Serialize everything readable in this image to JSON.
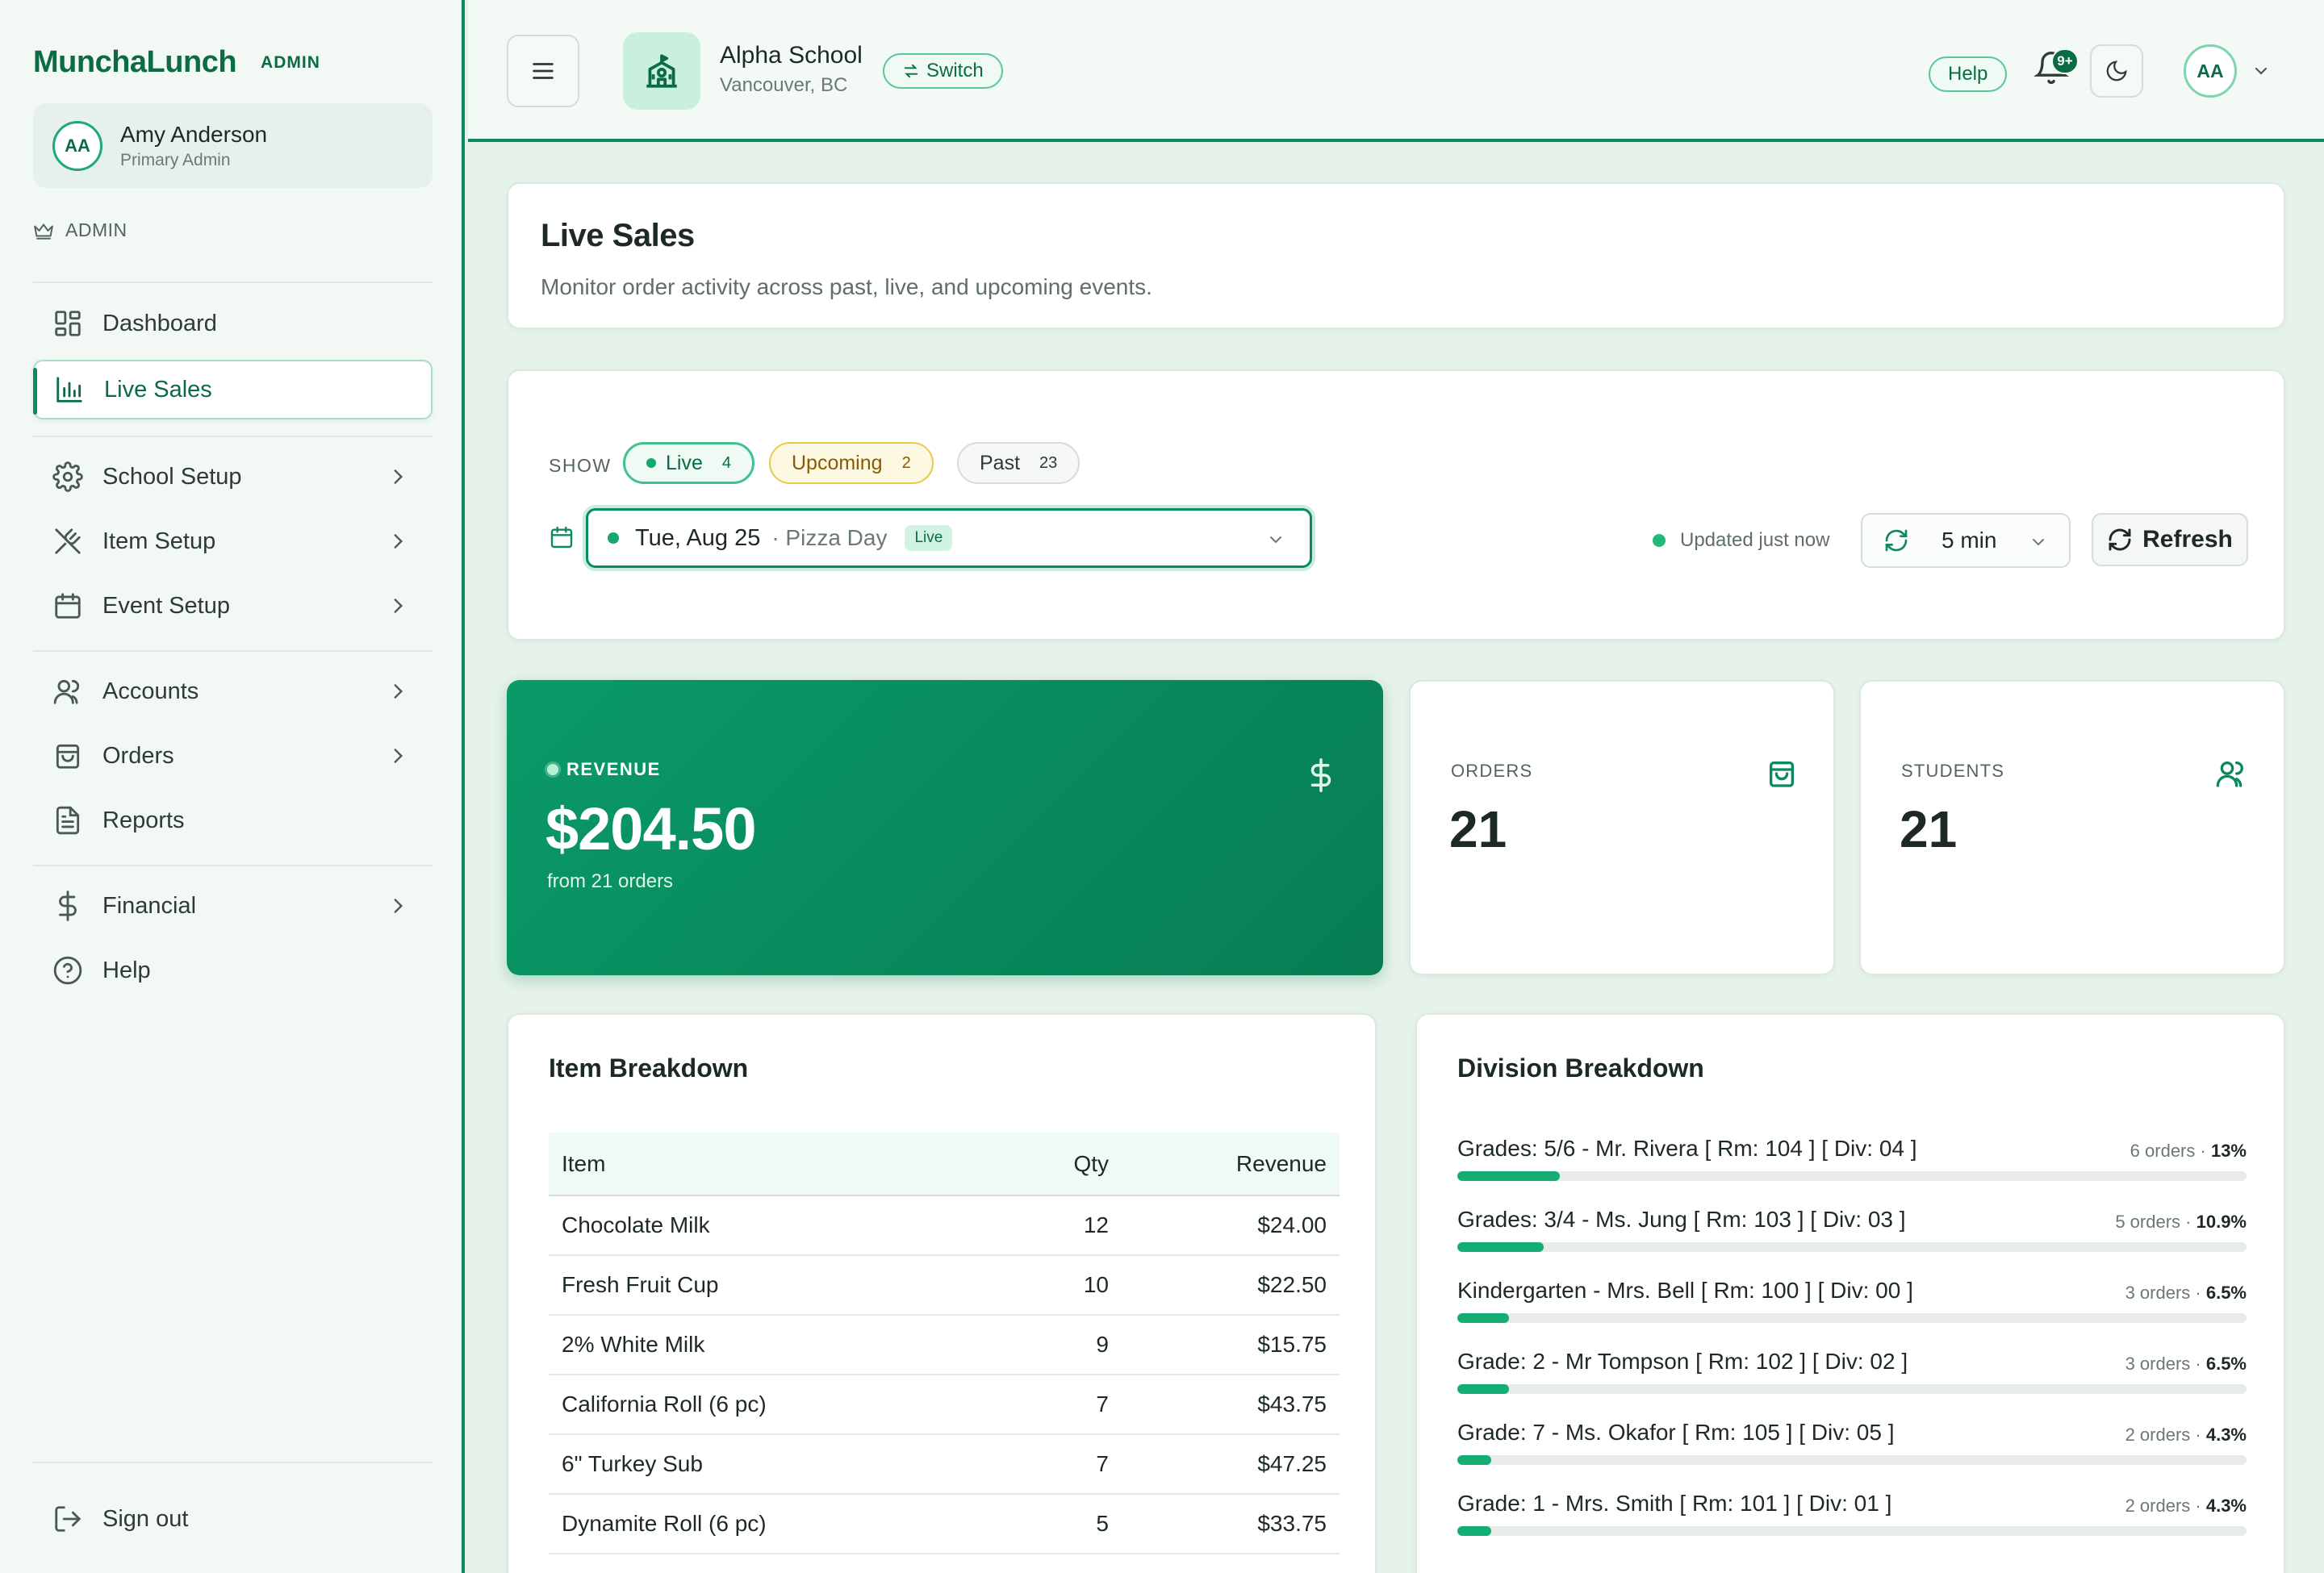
{
  "brand": {
    "name": "MunchaLunch",
    "tag": "ADMIN"
  },
  "user": {
    "initials": "AA",
    "name": "Amy Anderson",
    "role": "Primary Admin"
  },
  "sidebar": {
    "role_label": "ADMIN",
    "items": [
      {
        "label": "Dashboard",
        "icon": "dashboard-icon"
      },
      {
        "label": "Live Sales",
        "icon": "bar-chart-icon",
        "active": true
      },
      {
        "label": "School Setup",
        "icon": "gear-icon"
      },
      {
        "label": "Item Setup",
        "icon": "utensils-icon"
      },
      {
        "label": "Event Setup",
        "icon": "calendar-icon"
      },
      {
        "label": "Accounts",
        "icon": "users-icon"
      },
      {
        "label": "Orders",
        "icon": "shopping-bag-icon"
      },
      {
        "label": "Reports",
        "icon": "document-icon"
      },
      {
        "label": "Financial",
        "icon": "dollar-icon"
      },
      {
        "label": "Help",
        "icon": "help-circle-icon"
      }
    ],
    "sign_out": "Sign out"
  },
  "header": {
    "school_name": "Alpha School",
    "school_location": "Vancouver, BC",
    "switch_label": "Switch",
    "help_label": "Help",
    "notification_badge": "9+",
    "avatar_initials": "AA"
  },
  "page": {
    "title": "Live Sales",
    "subtitle": "Monitor order activity across past, live, and upcoming events."
  },
  "filters": {
    "show_label": "SHOW",
    "live": {
      "label": "Live",
      "count": "4"
    },
    "upcoming": {
      "label": "Upcoming",
      "count": "2"
    },
    "past": {
      "label": "Past",
      "count": "23"
    },
    "event": {
      "date": "Tue, Aug 25",
      "name": "· Pizza Day",
      "badge": "Live"
    },
    "updated_text": "Updated just now",
    "interval": "5 min",
    "refresh_label": "Refresh"
  },
  "kpis": {
    "revenue": {
      "label": "REVENUE",
      "value": "$204.50",
      "sub": "from 21 orders"
    },
    "orders": {
      "label": "ORDERS",
      "value": "21"
    },
    "students": {
      "label": "STUDENTS",
      "value": "21"
    }
  },
  "item_breakdown": {
    "title": "Item Breakdown",
    "columns": [
      "Item",
      "Qty",
      "Revenue"
    ],
    "rows": [
      {
        "item": "Chocolate Milk",
        "qty": "12",
        "revenue": "$24.00"
      },
      {
        "item": "Fresh Fruit Cup",
        "qty": "10",
        "revenue": "$22.50"
      },
      {
        "item": "2% White Milk",
        "qty": "9",
        "revenue": "$15.75"
      },
      {
        "item": "California Roll (6 pc)",
        "qty": "7",
        "revenue": "$43.75"
      },
      {
        "item": "6\" Turkey Sub",
        "qty": "7",
        "revenue": "$47.25"
      },
      {
        "item": "Dynamite Roll (6 pc)",
        "qty": "5",
        "revenue": "$33.75"
      }
    ]
  },
  "division_breakdown": {
    "title": "Division Breakdown",
    "rows": [
      {
        "name": "Grades: 5/6 - Mr. Rivera [ Rm: 104 ] [ Div: 04 ]",
        "orders": "6 orders",
        "pct": "13%",
        "fraction": 0.13
      },
      {
        "name": "Grades: 3/4 - Ms. Jung [ Rm: 103 ] [ Div: 03 ]",
        "orders": "5 orders",
        "pct": "10.9%",
        "fraction": 0.109
      },
      {
        "name": "Kindergarten - Mrs. Bell [ Rm: 100 ] [ Div: 00 ]",
        "orders": "3 orders",
        "pct": "6.5%",
        "fraction": 0.065
      },
      {
        "name": "Grade: 2 - Mr Tompson [ Rm: 102 ] [ Div: 02 ]",
        "orders": "3 orders",
        "pct": "6.5%",
        "fraction": 0.065
      },
      {
        "name": "Grade: 7 - Ms. Okafor [ Rm: 105 ] [ Div: 05 ]",
        "orders": "2 orders",
        "pct": "4.3%",
        "fraction": 0.043
      },
      {
        "name": "Grade: 1 - Mrs. Smith [ Rm: 101 ] [ Div: 01 ]",
        "orders": "2 orders",
        "pct": "4.3%",
        "fraction": 0.043
      }
    ]
  },
  "colors": {
    "brand": "#0b6b45",
    "accent": "#0a8a5e",
    "bar": "#14ad74"
  }
}
